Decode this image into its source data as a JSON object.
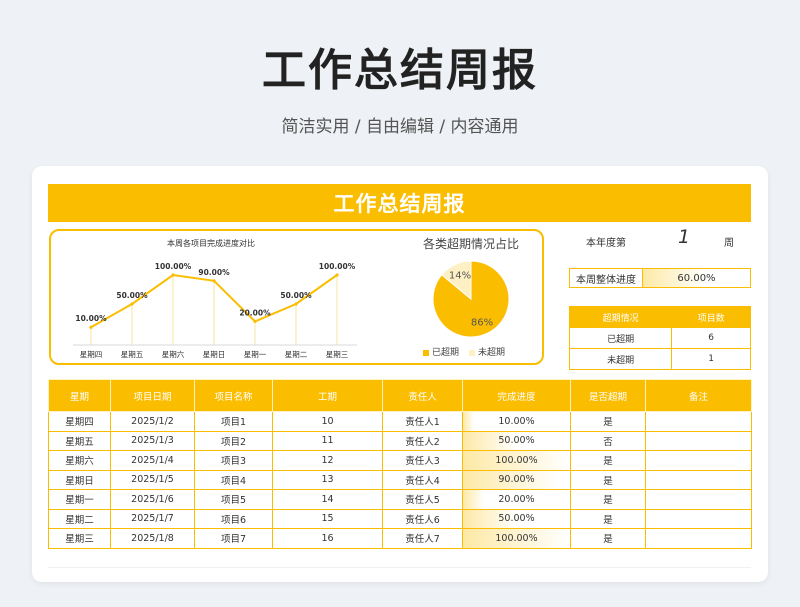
{
  "page": {
    "title": "工作总结周报",
    "subtitle": "简洁实用 / 自由编辑 / 内容通用"
  },
  "banner": {
    "title": "工作总结周报"
  },
  "week": {
    "label": "本年度第",
    "number": "1",
    "unit": "周"
  },
  "overall_progress": {
    "label": "本周整体进度",
    "value": "60.00%",
    "fraction": 0.6
  },
  "overdue_table": {
    "headers": [
      "超期情况",
      "项目数"
    ],
    "rows": [
      [
        "已超期",
        "6"
      ],
      [
        "未超期",
        "1"
      ]
    ]
  },
  "colors": {
    "accent": "#fbbd00",
    "pie_light": "#fdf0c4"
  },
  "chart_data": [
    {
      "type": "line",
      "title": "本周各项目完成进度对比",
      "categories": [
        "星期四",
        "星期五",
        "星期六",
        "星期日",
        "星期一",
        "星期二",
        "星期三"
      ],
      "values": [
        10,
        50,
        100,
        90,
        20,
        50,
        100
      ],
      "data_labels": [
        "10.00%",
        "50.00%",
        "100.00%",
        "90.00%",
        "20.00%",
        "50.00%",
        "100.00%"
      ],
      "ylim": [
        0,
        100
      ],
      "grid": false
    },
    {
      "type": "pie",
      "title": "各类超期情况占比",
      "labels": [
        "已超期",
        "未超期"
      ],
      "values": [
        86,
        14
      ],
      "data_labels": [
        "86%",
        "14%"
      ],
      "colors": [
        "#fbbd00",
        "#fdf0c4"
      ],
      "legend": "bottom"
    }
  ],
  "main_table": {
    "headers": [
      "星期",
      "项目日期",
      "项目名称",
      "工期",
      "责任人",
      "完成进度",
      "是否超期",
      "备注"
    ],
    "rows": [
      {
        "day": "星期四",
        "date": "2025/1/2",
        "name": "项目1",
        "duration": "10",
        "owner": "责任人1",
        "progress": "10.00%",
        "progress_fraction": 0.1,
        "overdue": "是",
        "note": ""
      },
      {
        "day": "星期五",
        "date": "2025/1/3",
        "name": "项目2",
        "duration": "11",
        "owner": "责任人2",
        "progress": "50.00%",
        "progress_fraction": 0.5,
        "overdue": "否",
        "note": ""
      },
      {
        "day": "星期六",
        "date": "2025/1/4",
        "name": "项目3",
        "duration": "12",
        "owner": "责任人3",
        "progress": "100.00%",
        "progress_fraction": 1.0,
        "overdue": "是",
        "note": ""
      },
      {
        "day": "星期日",
        "date": "2025/1/5",
        "name": "项目4",
        "duration": "13",
        "owner": "责任人4",
        "progress": "90.00%",
        "progress_fraction": 0.9,
        "overdue": "是",
        "note": ""
      },
      {
        "day": "星期一",
        "date": "2025/1/6",
        "name": "项目5",
        "duration": "14",
        "owner": "责任人5",
        "progress": "20.00%",
        "progress_fraction": 0.2,
        "overdue": "是",
        "note": ""
      },
      {
        "day": "星期二",
        "date": "2025/1/7",
        "name": "项目6",
        "duration": "15",
        "owner": "责任人6",
        "progress": "50.00%",
        "progress_fraction": 0.5,
        "overdue": "是",
        "note": ""
      },
      {
        "day": "星期三",
        "date": "2025/1/8",
        "name": "项目7",
        "duration": "16",
        "owner": "责任人7",
        "progress": "100.00%",
        "progress_fraction": 1.0,
        "overdue": "是",
        "note": ""
      }
    ]
  }
}
